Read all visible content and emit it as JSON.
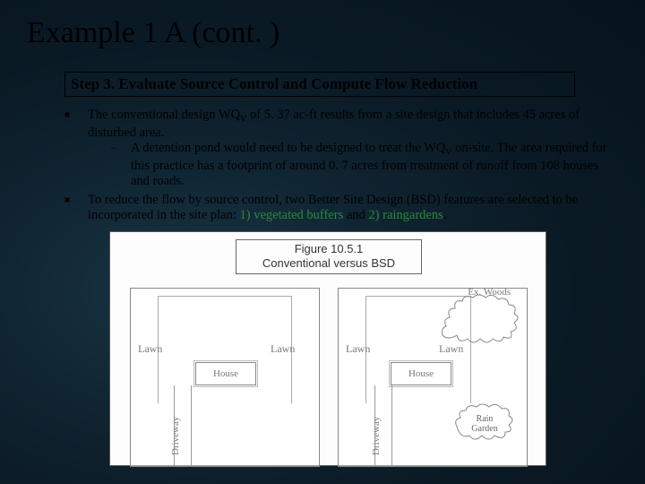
{
  "title": "Example 1 A (cont. )",
  "step_heading": "Step 3. Evaluate Source Control and Compute Flow Reduction",
  "bullets": {
    "b1": {
      "pre": "The conventional design WQ",
      "sub": "V",
      "post": " of 5. 37 ac-ft results from a site design that includes 45 acres of disturbed area."
    },
    "b1a": {
      "pre": "A detention pond would need to be designed to treat the WQ",
      "sub": "V",
      "post": " on-site.  The area required for this practice has a footprint of around 0. 7 acres from treatment of runoff from 108 houses and roads."
    },
    "b2": {
      "pre": "To reduce the flow by source control, two Better Site Design (BSD) features are selected to be incorporated in the site plan: ",
      "h1": "1) vegetated buffers",
      "mid": " and ",
      "h2": "2) raingardens",
      "post": "."
    }
  },
  "figure": {
    "caption_line1": "Figure 10.5.1",
    "caption_line2": "Conventional versus BSD",
    "lawn": "Lawn",
    "house": "House",
    "driveway": "Driveway",
    "ex_woods": "Ex. Woods",
    "rain_garden_l1": "Rain",
    "rain_garden_l2": "Garden"
  }
}
